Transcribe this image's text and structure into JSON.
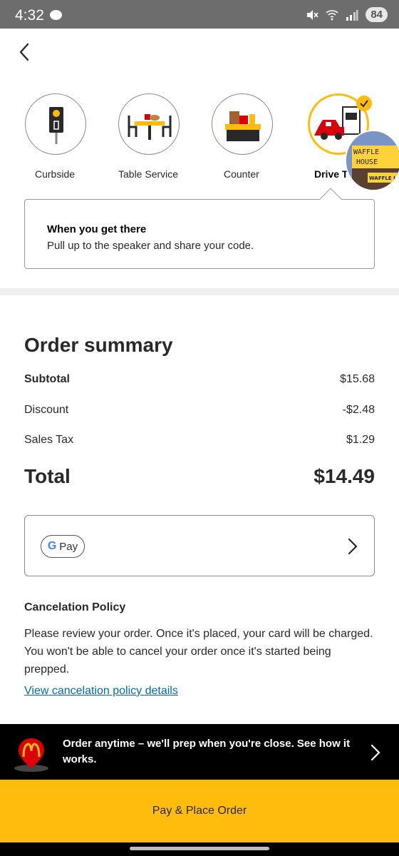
{
  "status_bar": {
    "time": "4:32",
    "battery": "84"
  },
  "service_options": [
    {
      "label": "Curbside",
      "icon": "curbside-icon",
      "selected": false
    },
    {
      "label": "Table Service",
      "icon": "table-service-icon",
      "selected": false
    },
    {
      "label": "Counter",
      "icon": "counter-icon",
      "selected": false
    },
    {
      "label": "Drive T",
      "icon": "drive-thru-icon",
      "selected": true
    }
  ],
  "sticker": {
    "line1": "WAFFLE",
    "line2": "HOUSE",
    "line3": "WAFFLE H"
  },
  "info_box": {
    "title": "When you get there",
    "text": "Pull up to the speaker and share your code."
  },
  "order_summary": {
    "title": "Order summary",
    "rows": [
      {
        "label": "Subtotal",
        "value": "$15.68"
      },
      {
        "label": "Discount",
        "value": "-$2.48"
      },
      {
        "label": "Sales Tax",
        "value": "$1.29"
      }
    ],
    "total_label": "Total",
    "total_value": "$14.49"
  },
  "payment": {
    "method_g": "G",
    "method_label": "Pay"
  },
  "cancelation": {
    "title": "Cancelation Policy",
    "text": "Please review your order. Once it's placed, your card will be charged. You won't be able to cancel your order once it's started being prepped.",
    "link": "View cancelation policy details"
  },
  "promo": {
    "text": "Order anytime – we'll prep when you're close. See how it works."
  },
  "cta": {
    "label": "Pay & Place Order"
  },
  "colors": {
    "accent": "#ffbc0d",
    "link": "#006bae",
    "text": "#292929",
    "mcd_red": "#db0007"
  }
}
